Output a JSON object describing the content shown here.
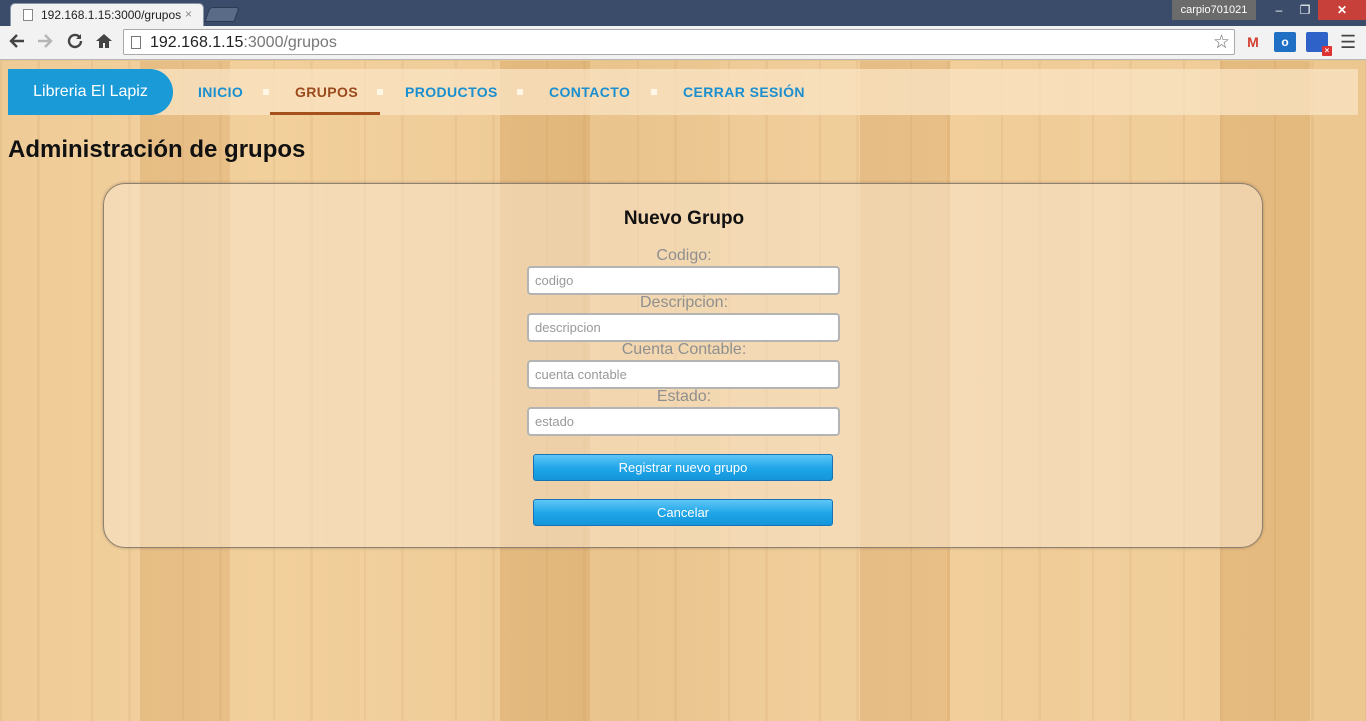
{
  "browser": {
    "tab_title": "192.168.1.15:3000/grupos",
    "tab_close": "×",
    "user": "carpio701021",
    "window_controls": {
      "minimize": "–",
      "maximize": "❐",
      "close": "✕"
    },
    "url_host": "192.168.1.15",
    "url_path": ":3000/grupos",
    "icons": {
      "back": "back-arrow-icon",
      "forward": "forward-arrow-icon",
      "reload": "reload-icon",
      "home": "home-icon",
      "star": "bookmark-star-icon",
      "menu": "menu-icon"
    },
    "extensions": {
      "gmail": "M",
      "outlook": "o"
    }
  },
  "navbar": {
    "brand": "Libreria El Lapiz",
    "links": [
      {
        "label": "INICIO",
        "active": false
      },
      {
        "label": "GRUPOS",
        "active": true
      },
      {
        "label": "PRODUCTOS",
        "active": false
      },
      {
        "label": "CONTACTO",
        "active": false
      },
      {
        "label": "CERRAR SESIÓN",
        "active": false
      }
    ],
    "colors": {
      "brand_bg": "#1a9ad6",
      "link": "#1a8fd0",
      "active": "#9a4a1c"
    }
  },
  "page": {
    "title": "Administración de grupos"
  },
  "form": {
    "title": "Nuevo Grupo",
    "fields": [
      {
        "label": "Codigo:",
        "placeholder": "codigo",
        "value": ""
      },
      {
        "label": "Descripcion:",
        "placeholder": "descripcion",
        "value": ""
      },
      {
        "label": "Cuenta Contable:",
        "placeholder": "cuenta contable",
        "value": ""
      },
      {
        "label": "Estado:",
        "placeholder": "estado",
        "value": ""
      }
    ],
    "submit_label": "Registrar nuevo grupo",
    "cancel_label": "Cancelar",
    "button_color": "#1ea4e8"
  }
}
